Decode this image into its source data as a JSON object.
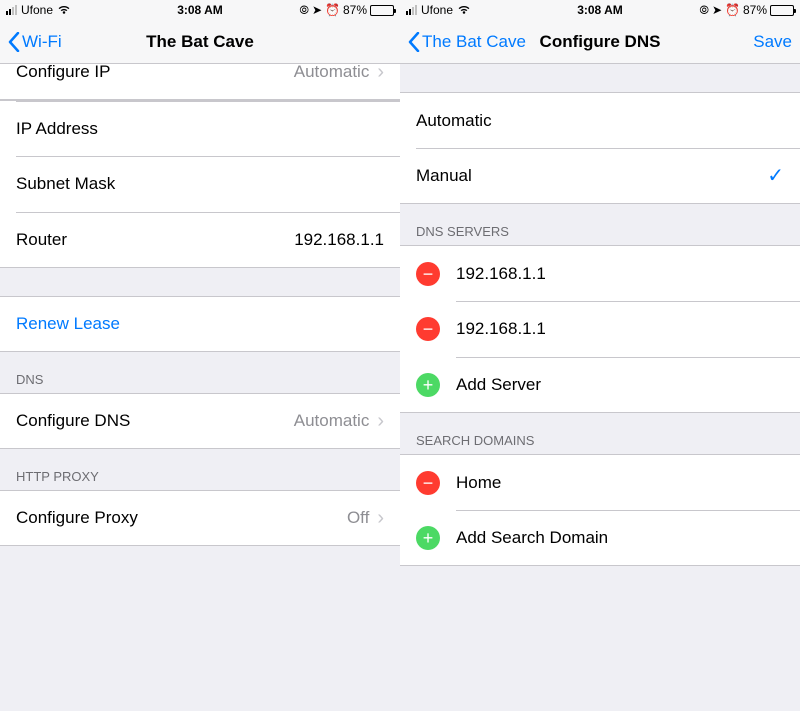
{
  "statusbar": {
    "carrier": "Ufone",
    "time": "3:08 AM",
    "battery_pct": "87%"
  },
  "left": {
    "nav": {
      "back": "Wi-Fi",
      "title": "The Bat Cave"
    },
    "rows": {
      "configure_ip": {
        "label": "Configure IP",
        "value": "Automatic"
      },
      "ip_address": {
        "label": "IP Address"
      },
      "subnet_mask": {
        "label": "Subnet Mask"
      },
      "router": {
        "label": "Router",
        "value": "192.168.1.1"
      },
      "renew_lease": {
        "label": "Renew Lease"
      }
    },
    "sections": {
      "dns": {
        "header": "DNS",
        "configure_dns": {
          "label": "Configure DNS",
          "value": "Automatic"
        }
      },
      "http_proxy": {
        "header": "HTTP Proxy",
        "configure_proxy": {
          "label": "Configure Proxy",
          "value": "Off"
        }
      }
    }
  },
  "right": {
    "nav": {
      "back": "The Bat Cave",
      "title": "Configure DNS",
      "save": "Save"
    },
    "mode": {
      "automatic": "Automatic",
      "manual": "Manual",
      "selected": "manual"
    },
    "dns_servers": {
      "header": "DNS Servers",
      "items": [
        "192.168.1.1",
        "192.168.1.1"
      ],
      "add": "Add Server"
    },
    "search_domains": {
      "header": "Search Domains",
      "items": [
        "Home"
      ],
      "add": "Add Search Domain"
    }
  }
}
